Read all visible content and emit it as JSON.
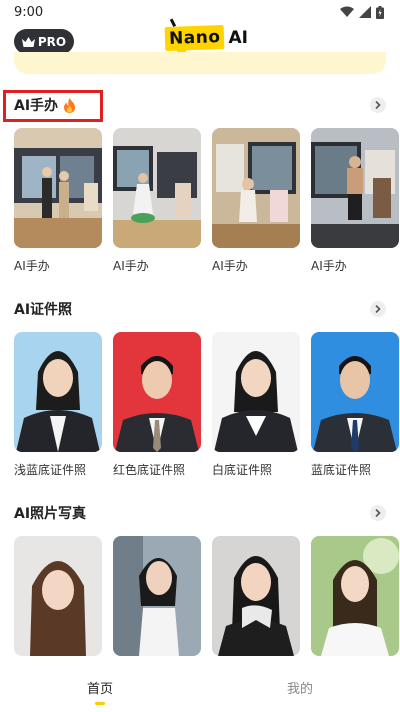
{
  "status": {
    "time": "9:00"
  },
  "header": {
    "pro_label": "PRO",
    "logo_word": "Nano",
    "logo_suffix": "AI"
  },
  "sections": [
    {
      "title": "AI手办",
      "has_fire_icon": true,
      "cards": [
        {
          "label": "AI手办"
        },
        {
          "label": "AI手办"
        },
        {
          "label": "AI手办"
        },
        {
          "label": "AI手办"
        }
      ]
    },
    {
      "title": "AI证件照",
      "cards": [
        {
          "label": "浅蓝底证件照"
        },
        {
          "label": "红色底证件照"
        },
        {
          "label": "白底证件照"
        },
        {
          "label": "蓝底证件照"
        }
      ]
    },
    {
      "title": "AI照片写真",
      "cards": [
        {
          "label": ""
        },
        {
          "label": ""
        },
        {
          "label": ""
        },
        {
          "label": ""
        }
      ]
    }
  ],
  "nav": {
    "home": "首页",
    "mine": "我的"
  },
  "colors": {
    "accent": "#ffcc00",
    "logo_yellow": "#ffd400",
    "highlight": "#e02020",
    "pro_bg": "#2f3136"
  }
}
